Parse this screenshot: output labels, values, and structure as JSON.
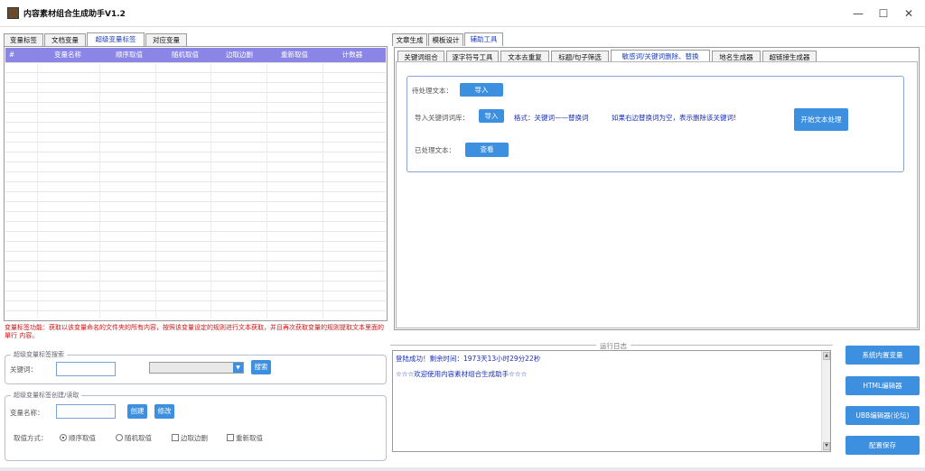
{
  "window": {
    "title": "内容素材组合生成助手V1.2",
    "minimize": "—",
    "maximize": "☐",
    "close": "✕"
  },
  "left_tabs": [
    "变量标签",
    "文档变量",
    "超级变量标签",
    "对应变量"
  ],
  "left_active": 2,
  "grid": {
    "columns": [
      "#",
      "变量名称",
      "顺序取值",
      "随机取值",
      "边取边删",
      "重新取值",
      "计数器"
    ]
  },
  "hint": "变量标签功能：获取以该变量命名的文件夹的所有内容，按照该变量设定的规则进行文本获取，并且再次获取变量的规则提取文本里面的 單行 内容。",
  "search_group": {
    "legend": "超级变量标签搜索",
    "keyword_label": "关键词：",
    "keyword_value": "",
    "select_value": "",
    "search_button": "搜索"
  },
  "create_group": {
    "legend": "超级变量标签创建/读取",
    "name_label": "变量名称：",
    "name_value": "",
    "create_button": "创建",
    "edit_button": "修改",
    "mode_label": "取值方式：",
    "modes": [
      "顺序取值",
      "随机取值",
      "边取边删",
      "重新取值"
    ]
  },
  "right_tabs": [
    "文章生成",
    "模板设计",
    "辅助工具"
  ],
  "right_active": 2,
  "sub_tabs": [
    "关键词组合",
    "逐字符号工具",
    "文本去重复",
    "标题/句子筛选",
    "敏感词/关键词删除、替换",
    "地名生成器",
    "超链接生成器"
  ],
  "sub_active": 4,
  "tool": {
    "pending_label": "待处理文本：",
    "import1": "导入",
    "import_kw_label": "导入关键词词库：",
    "import2": "导入",
    "format_text": "格式：关键词——替换词",
    "note_text": "如果右边替换词为空，表示删除该关键词!",
    "start_button": "开始文本处理",
    "processed_label": "已处理文本：",
    "view_button": "查看"
  },
  "log": {
    "title": "运行日志",
    "lines": [
      "登陆成功！剩余时间：1973天13小时29分22秒",
      "☆☆☆欢迎使用内容素材组合生成助手☆☆☆"
    ]
  },
  "side_buttons": [
    "系统内置变量",
    "HTML编辑器",
    "UBB编辑器(论坛)",
    "配置保存"
  ],
  "colors": {
    "accent": "#3d8fe0",
    "grid_header": "#8b86e6",
    "hint": "#d01010",
    "link": "#1a2fb8"
  }
}
